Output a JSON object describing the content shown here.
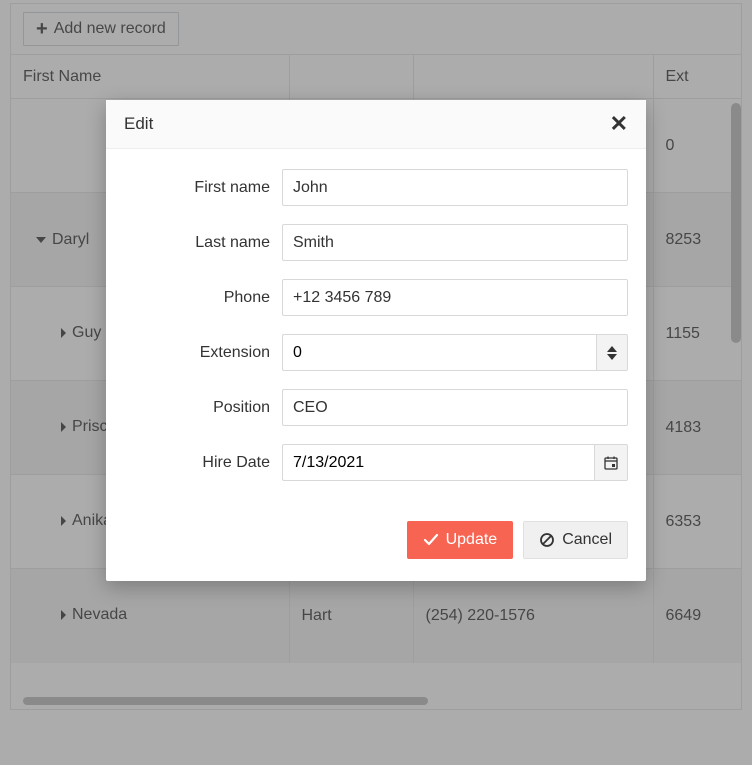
{
  "toolbar": {
    "add_label": "Add new record"
  },
  "columns": {
    "first": "First Name",
    "last": "",
    "phone": "",
    "ext": "Ext"
  },
  "rows": [
    {
      "first": "",
      "last": "",
      "phone": "",
      "ext": "0",
      "expanded": false,
      "indent": 0
    },
    {
      "first": "Daryl",
      "last": "",
      "phone": "",
      "ext": "8253",
      "expanded": true,
      "indent": 0
    },
    {
      "first": "Guy",
      "last": "",
      "phone": "",
      "ext": "1155",
      "expanded": false,
      "indent": 1
    },
    {
      "first": "Priscilla",
      "last": "",
      "phone": "",
      "ext": "4183",
      "expanded": false,
      "indent": 1
    },
    {
      "first": "Anika",
      "last": "",
      "phone": "",
      "ext": "6353",
      "expanded": false,
      "indent": 1
    },
    {
      "first": "Nevada",
      "last": "Hart",
      "phone": "(254) 220-1576",
      "ext": "6649",
      "expanded": false,
      "indent": 1
    }
  ],
  "modal": {
    "title": "Edit",
    "fields": {
      "firstName": {
        "label": "First name",
        "value": "John"
      },
      "lastName": {
        "label": "Last name",
        "value": "Smith"
      },
      "phone": {
        "label": "Phone",
        "value": "+12 3456 789"
      },
      "extension": {
        "label": "Extension",
        "value": "0"
      },
      "position": {
        "label": "Position",
        "value": "CEO"
      },
      "hireDate": {
        "label": "Hire Date",
        "value": "7/13/2021"
      }
    },
    "buttons": {
      "update": "Update",
      "cancel": "Cancel"
    }
  }
}
